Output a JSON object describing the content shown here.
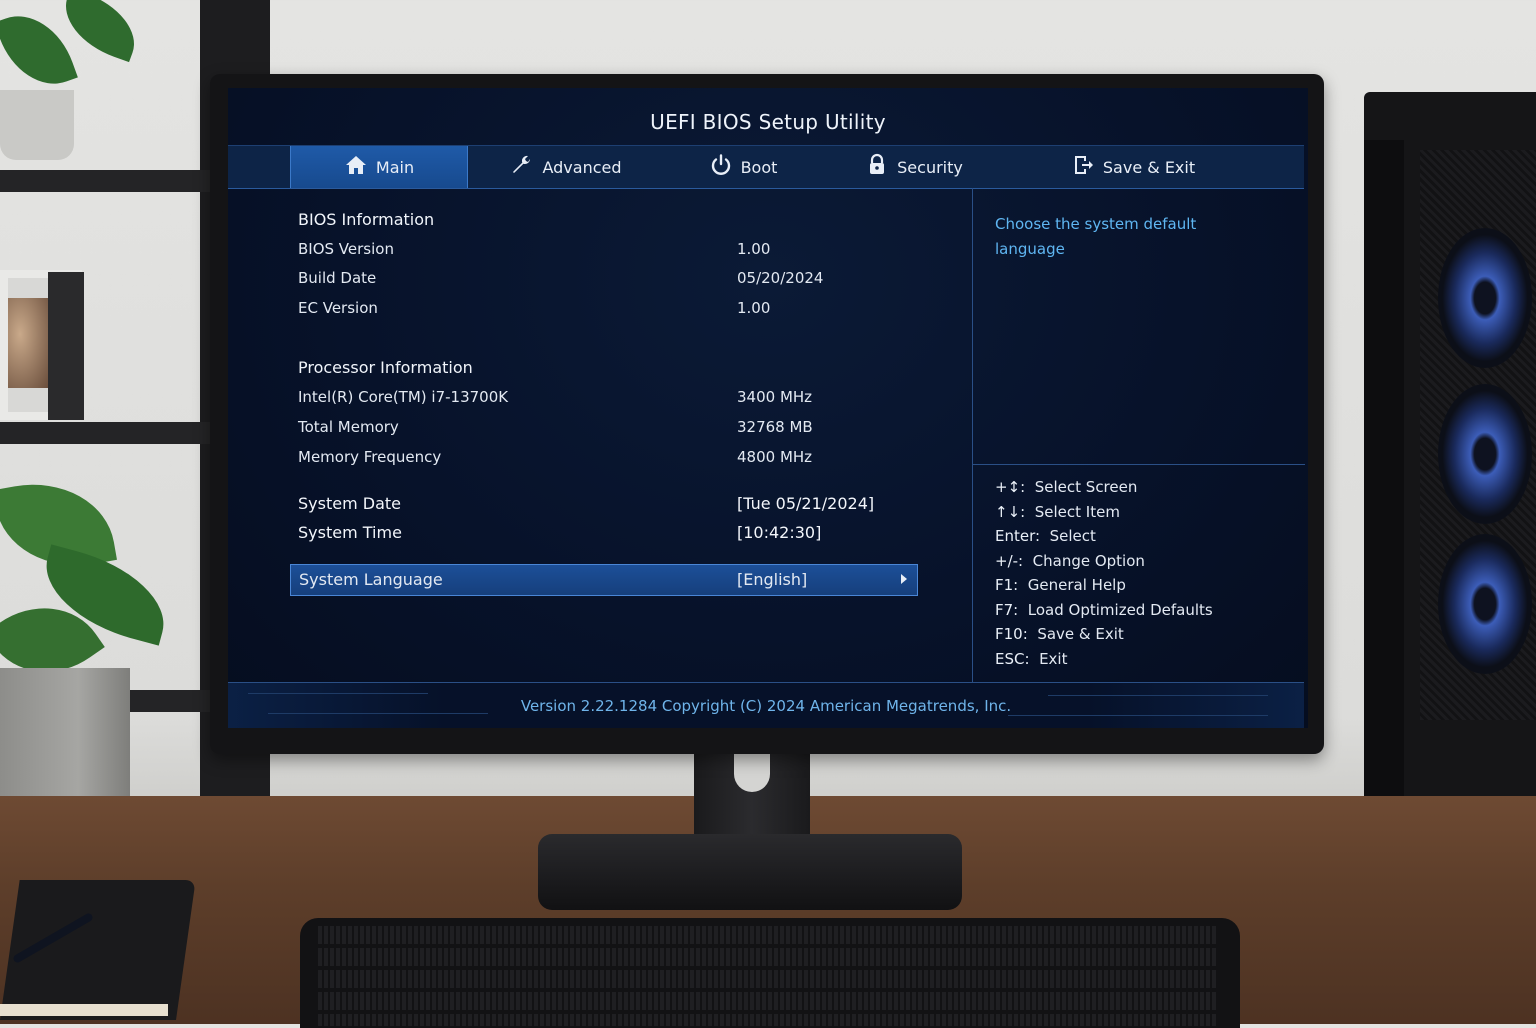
{
  "window": {
    "title": "UEFI BIOS Setup Utility"
  },
  "tabs": [
    {
      "label": "Main",
      "icon": "home-icon",
      "active": true
    },
    {
      "label": "Advanced",
      "icon": "wrench-icon",
      "active": false
    },
    {
      "label": "Boot",
      "icon": "power-icon",
      "active": false
    },
    {
      "label": "Security",
      "icon": "lock-icon",
      "active": false
    },
    {
      "label": "Save & Exit",
      "icon": "exit-icon",
      "active": false
    }
  ],
  "main": {
    "bios_info": {
      "header": "BIOS Information",
      "items": [
        {
          "label": "BIOS Version",
          "value": "1.00"
        },
        {
          "label": "Build Date",
          "value": "05/20/2024"
        },
        {
          "label": "EC Version",
          "value": "1.00"
        }
      ]
    },
    "processor_info": {
      "header": "Processor Information",
      "items": [
        {
          "label": "Intel(R) Core(TM) i7-13700K",
          "value": "3400 MHz"
        },
        {
          "label": "Total Memory",
          "value": "32768 MB"
        },
        {
          "label": "Memory Frequency",
          "value": "4800 MHz"
        }
      ]
    },
    "system_date": {
      "label": "System Date",
      "value": "[Tue 05/21/2024]"
    },
    "system_time": {
      "label": "System Time",
      "value": "[10:42:30]"
    },
    "system_language": {
      "label": "System Language",
      "value": "[English]"
    }
  },
  "help": {
    "description": "Choose the system default language"
  },
  "key_help": [
    {
      "key": "+↕:",
      "action": "Select Screen"
    },
    {
      "key": "↑↓:",
      "action": "Select Item"
    },
    {
      "key": "Enter:",
      "action": "Select"
    },
    {
      "key": "+/-:",
      "action": "Change Option"
    },
    {
      "key": "F1:",
      "action": "General Help"
    },
    {
      "key": "F7:",
      "action": "Load Optimized Defaults"
    },
    {
      "key": "F10:",
      "action": "Save & Exit"
    },
    {
      "key": "ESC:",
      "action": "Exit"
    }
  ],
  "footer": {
    "text": "Version 2.22.1284 Copyright (C) 2024 American Megatrends, Inc."
  },
  "colors": {
    "screen_bg": "#07122a",
    "menubar_bg": "#0d2447",
    "active_tab": "#1f5aa8",
    "selection": "#1c4f98",
    "help_text": "#5fb6f2",
    "footer_text": "#6fb4ea"
  }
}
